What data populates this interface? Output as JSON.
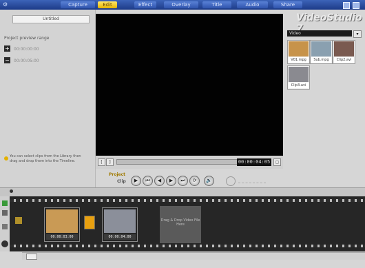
{
  "steps": [
    {
      "label": "Capture"
    },
    {
      "label": "Edit"
    },
    {
      "label": "Effect"
    },
    {
      "label": "Overlay"
    },
    {
      "label": "Title"
    },
    {
      "label": "Audio"
    },
    {
      "label": "Share"
    }
  ],
  "gear_glyph": "⚙",
  "left_panel": {
    "tab_label": "Untitled",
    "section_label": "Project preview range",
    "option1": "00:00:00:00",
    "option2": "00:00:05:00",
    "hint_text": "You can select clips from the Library then drag and drop them into the Timeline."
  },
  "player": {
    "timecode": "00:00:04:05",
    "mode_project": "Project",
    "mode_clip": "Clip"
  },
  "transport": [
    "▶",
    "⏮",
    "◀",
    "▶",
    "⏭",
    "⟳",
    "🔊"
  ],
  "brand": "VideoStudio 7",
  "library": {
    "folder_value": "Video",
    "thumbs": [
      {
        "caption": "V01.mpg",
        "color": "#c7934a"
      },
      {
        "caption": "Sub.mpg",
        "color": "#8aa0b0"
      },
      {
        "caption": "Clip2.avi",
        "color": "#7a5a50"
      },
      {
        "caption": "Clip3.avi",
        "color": "#8a8a90"
      }
    ]
  },
  "timeline": {
    "clips": [
      {
        "time": "00:00:03:00",
        "color": "#c99a55"
      },
      {
        "time": "00:00:04:00",
        "color": "#8b8f9a"
      }
    ],
    "drop_text": "Drag & Drop Video File Here"
  },
  "colors": {
    "accent": "#e6b400",
    "stepbar": "#2f54ad"
  }
}
